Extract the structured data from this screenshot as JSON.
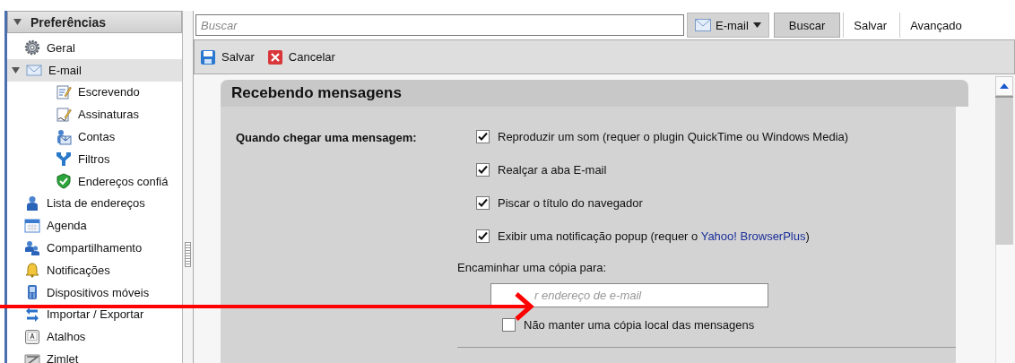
{
  "sidebar": {
    "title": "Preferências",
    "expanded": true,
    "items": [
      {
        "label": "Geral",
        "selected": false
      },
      {
        "label": "E-mail",
        "selected": true,
        "expanded": true,
        "children": [
          {
            "label": "Escrevendo",
            "selected": false
          },
          {
            "label": "Assinaturas",
            "selected": false
          },
          {
            "label": "Contas",
            "selected": false
          },
          {
            "label": "Filtros",
            "selected": false
          },
          {
            "label": "Endereços confiá",
            "selected": false
          }
        ]
      },
      {
        "label": "Lista de endereços",
        "selected": false
      },
      {
        "label": "Agenda",
        "selected": false
      },
      {
        "label": "Compartilhamento",
        "selected": false
      },
      {
        "label": "Notificações",
        "selected": false
      },
      {
        "label": "Dispositivos móveis",
        "selected": false
      },
      {
        "label": "Importar / Exportar",
        "selected": false
      },
      {
        "label": "Atalhos",
        "selected": false
      },
      {
        "label": "Zimlet",
        "selected": false
      }
    ]
  },
  "search": {
    "placeholder": "Buscar"
  },
  "search_type": {
    "label": "E-mail"
  },
  "buttons": [
    {
      "label": "Buscar",
      "kind": "raised"
    },
    {
      "label": "Salvar",
      "kind": "flat"
    },
    {
      "label": "Avançado",
      "kind": "flat"
    }
  ],
  "toolbar": [
    {
      "label": "Salvar",
      "kind": "save"
    },
    {
      "label": "Cancelar",
      "kind": "cancel"
    }
  ],
  "section": {
    "title": "Recebendo mensagens",
    "label": "Quando chegar uma mensagem:",
    "options": [
      {
        "text": "Reproduzir um som (requer o plugin QuickTime ou Windows Media)",
        "checked": true
      },
      {
        "text": "Realçar a aba E-mail",
        "checked": true
      },
      {
        "text": "Piscar o título do navegador",
        "checked": true
      },
      {
        "text": "Exibir uma notificação popup (requer o ",
        "link": "Yahoo! BrowserPlus",
        "suffix": ")",
        "checked": true
      }
    ],
    "forward": {
      "label": "Encaminhar uma cópia para:",
      "placeholder": "r endereço de e-mail"
    },
    "keep_local": {
      "label": "Não manter uma cópia local das mensagens",
      "checked": false
    }
  }
}
